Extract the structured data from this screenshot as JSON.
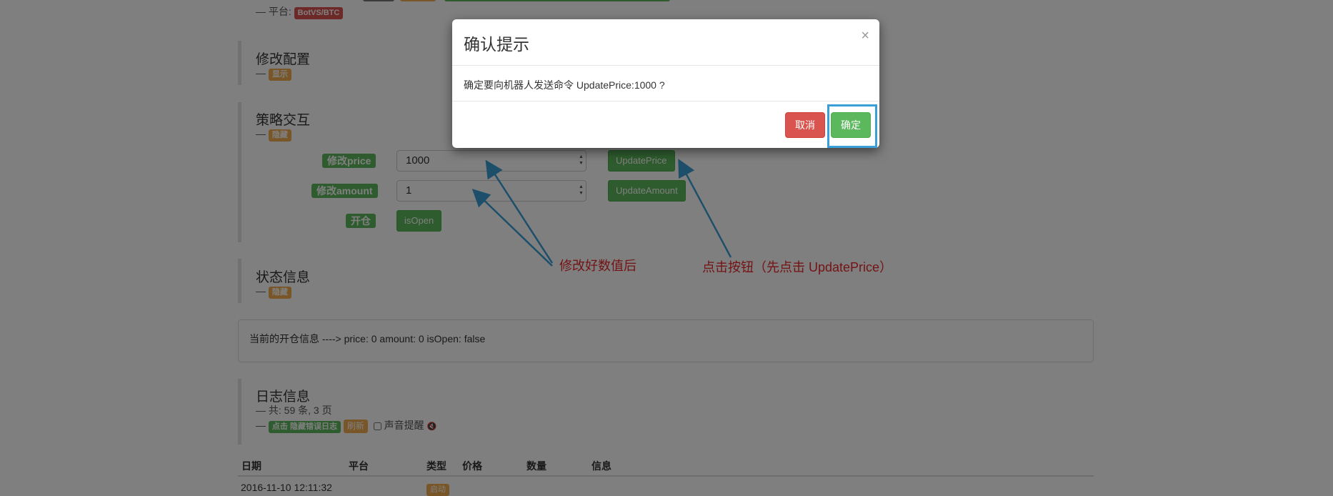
{
  "platform": {
    "prefix": "— 平台:",
    "badge": "BotVS/BTC"
  },
  "config": {
    "title": "修改配置",
    "dash": "—",
    "badge": "显示"
  },
  "strategy": {
    "title": "策略交互",
    "dash": "—",
    "badge": "隐藏",
    "rows": [
      {
        "label": "修改price",
        "value": "1000",
        "button": "UpdatePrice"
      },
      {
        "label": "修改amount",
        "value": "1",
        "button": "UpdateAmount"
      }
    ],
    "open_label": "开仓",
    "open_button": "isOpen"
  },
  "status": {
    "title": "状态信息",
    "dash": "—",
    "badge": "隐藏",
    "info": "当前的开仓信息 ----> price: 0 amount: 0 isOpen: false"
  },
  "log": {
    "title": "日志信息",
    "summary": "—  共: 59 条, 3 页",
    "dash": "—",
    "hide_errors": "点击 隐藏错误日志",
    "refresh": "刷新",
    "sound": "声音提醒",
    "sound_icon": "speaker-mute-icon",
    "columns": [
      "日期",
      "平台",
      "类型",
      "价格",
      "数量",
      "信息"
    ],
    "rows": [
      {
        "date": "2016-11-10 12:11:32",
        "type": "启动"
      }
    ]
  },
  "annotations": {
    "left": "修改好数值后",
    "right": "点击按钮（先点击 UpdatePrice）",
    "color": "#e8262a"
  },
  "modal": {
    "title": "确认提示",
    "close": "×",
    "message": "确定要向机器人发送命令 UpdatePrice:1000 ?",
    "cancel": "取消",
    "confirm": "确定"
  }
}
